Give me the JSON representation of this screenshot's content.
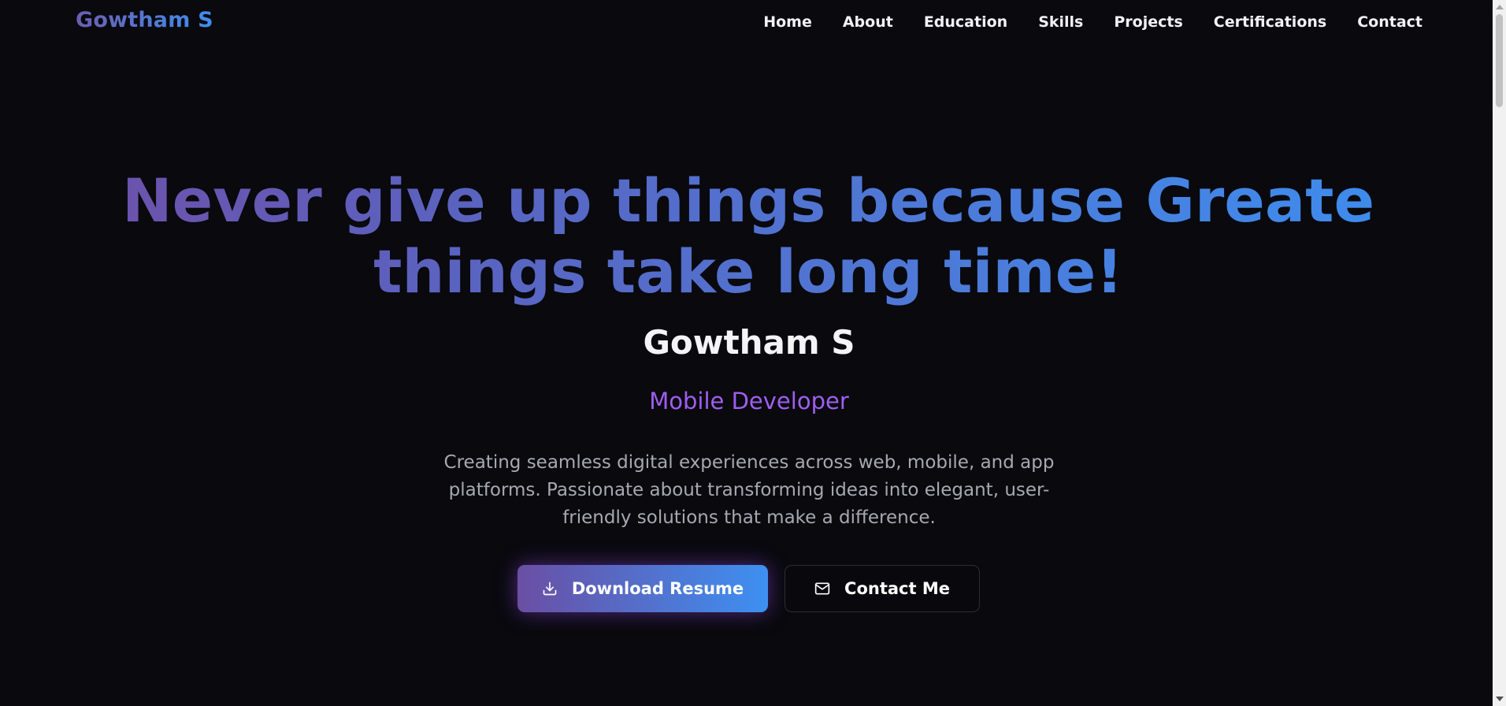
{
  "nav": {
    "logo": "Gowtham S",
    "links": [
      "Home",
      "About",
      "Education",
      "Skills",
      "Projects",
      "Certifications",
      "Contact"
    ]
  },
  "hero": {
    "title_line1": "Never give up things because Greate",
    "title_line2": "things take long time!",
    "name": "Gowtham S",
    "role": "Mobile Developer",
    "description": "Creating seamless digital experiences across web, mobile, and app platforms. Passionate about transforming ideas into elegant, user-friendly solutions that make a difference.",
    "download_label": "Download Resume",
    "contact_label": "Contact Me"
  },
  "icons": {
    "download": "download-icon",
    "contact": "mail-icon"
  },
  "colors": {
    "background": "#09090e",
    "gradient_start": "#6f4fa8",
    "gradient_end": "#3b8ff0",
    "role": "#a05ef0",
    "description": "#a8a8b2"
  }
}
